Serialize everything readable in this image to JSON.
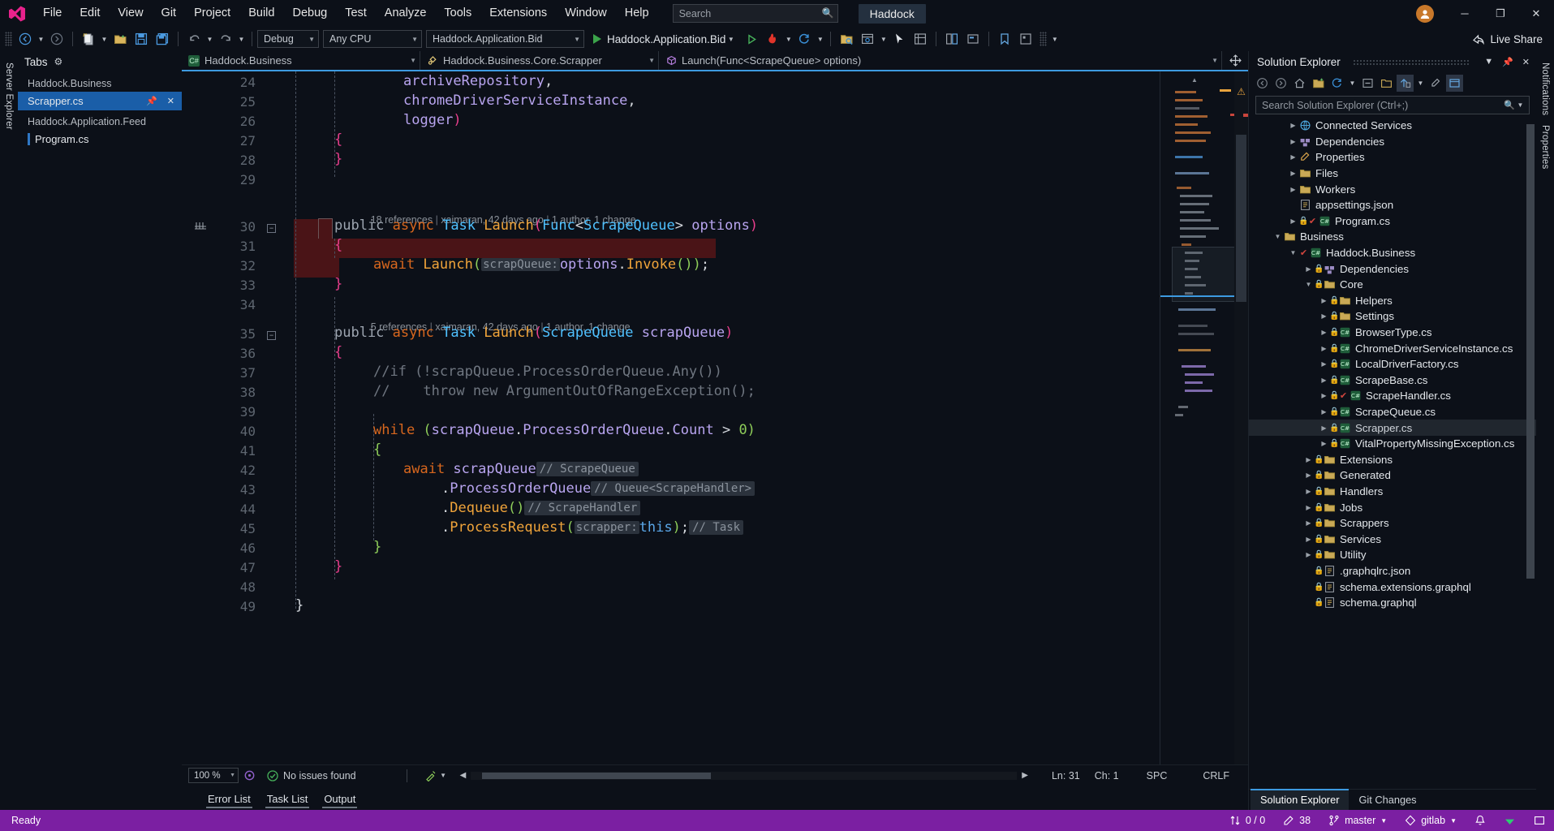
{
  "window": {
    "solution_name": "Haddock",
    "search_placeholder": "Search",
    "minimize": "─",
    "maximize": "❐",
    "close": "✕",
    "avatar_initial": ""
  },
  "menu": {
    "items": [
      {
        "label": "File"
      },
      {
        "label": "Edit"
      },
      {
        "label": "View"
      },
      {
        "label": "Git"
      },
      {
        "label": "Project"
      },
      {
        "label": "Build"
      },
      {
        "label": "Debug"
      },
      {
        "label": "Test"
      },
      {
        "label": "Analyze"
      },
      {
        "label": "Tools"
      },
      {
        "label": "Extensions"
      },
      {
        "label": "Window"
      },
      {
        "label": "Help"
      }
    ]
  },
  "toolbar": {
    "configuration": "Debug",
    "platform": "Any CPU",
    "startup_project": "Haddock.Application.Bid",
    "run_target": "Haddock.Application.Bid",
    "live_share": "Live Share"
  },
  "tool_rails": {
    "left_top": "Server Explorer",
    "right_top": "Notifications",
    "right_bottom": "Properties"
  },
  "tabs_window": {
    "title": "Tabs",
    "groups": [
      {
        "header": "Haddock.Business",
        "items": [
          {
            "label": "Scrapper.cs",
            "active": true,
            "pinned": true,
            "closable": true
          }
        ]
      },
      {
        "header": "Haddock.Application.Feed",
        "items": [
          {
            "label": "Program.cs",
            "active": false,
            "pinned": false,
            "closable": false
          }
        ]
      }
    ]
  },
  "navbar": {
    "project": "Haddock.Business",
    "type": "Haddock.Business.Core.Scrapper",
    "member": "Launch(Func<ScrapeQueue> options)"
  },
  "editor": {
    "first_line": 24,
    "lines": [
      {
        "n": 24,
        "indent": 4,
        "text": "        archiveRepository,"
      },
      {
        "n": 25,
        "indent": 4,
        "text": "        chromeDriverServiceInstance,"
      },
      {
        "n": 26,
        "indent": 4,
        "text": "        logger)"
      },
      {
        "n": 27,
        "indent": 2,
        "text": "    {"
      },
      {
        "n": 28,
        "indent": 2,
        "text": "    }"
      },
      {
        "n": 29,
        "indent": 0,
        "text": ""
      },
      {
        "n": 30,
        "indent": 2,
        "text": "    public async Task Launch(Func<ScrapeQueue> options)"
      },
      {
        "n": 31,
        "indent": 2,
        "text": "    {"
      },
      {
        "n": 32,
        "indent": 3,
        "text": "        await Launch(scrapQueue: options.Invoke());"
      },
      {
        "n": 33,
        "indent": 2,
        "text": "    }"
      },
      {
        "n": 34,
        "indent": 0,
        "text": ""
      },
      {
        "n": 35,
        "indent": 2,
        "text": "    public async Task Launch(ScrapeQueue scrapQueue)"
      },
      {
        "n": 36,
        "indent": 2,
        "text": "    {"
      },
      {
        "n": 37,
        "indent": 3,
        "text": "        //if (!scrapQueue.ProcessOrderQueue.Any())"
      },
      {
        "n": 38,
        "indent": 3,
        "text": "        //    throw new ArgumentOutOfRangeException();"
      },
      {
        "n": 39,
        "indent": 0,
        "text": ""
      },
      {
        "n": 40,
        "indent": 3,
        "text": "        while (scrapQueue.ProcessOrderQueue.Count > 0)"
      },
      {
        "n": 41,
        "indent": 3,
        "text": "        {"
      },
      {
        "n": 42,
        "indent": 4,
        "text": "            await scrapQueue"
      },
      {
        "n": 43,
        "indent": 5,
        "text": "                .ProcessOrderQueue"
      },
      {
        "n": 44,
        "indent": 5,
        "text": "                .Dequeue()"
      },
      {
        "n": 45,
        "indent": 5,
        "text": "                .ProcessRequest(scrapper: this);"
      },
      {
        "n": 46,
        "indent": 3,
        "text": "        }"
      },
      {
        "n": 47,
        "indent": 2,
        "text": "    }"
      },
      {
        "n": 48,
        "indent": 0,
        "text": ""
      },
      {
        "n": 49,
        "indent": 0,
        "text": "}"
      }
    ],
    "codelens": [
      {
        "at_line": 30,
        "references": "18 references",
        "author": "xaimaran, 42 days ago",
        "changes": "1 author, 1 change"
      },
      {
        "at_line": 35,
        "references": "5 references",
        "author": "xaimaran, 42 days ago",
        "changes": "1 author, 1 change"
      }
    ],
    "inline_hints": [
      {
        "at_line": 32,
        "text": "scrapQueue:"
      },
      {
        "at_line": 42,
        "text": "// ScrapeQueue"
      },
      {
        "at_line": 43,
        "text": "// Queue<ScrapeHandler>"
      },
      {
        "at_line": 44,
        "text": "// ScrapeHandler"
      },
      {
        "at_line": 45,
        "text": "// Task"
      },
      {
        "at_line": 45,
        "text": "scrapper:"
      }
    ],
    "highlighted_lines": [
      31,
      32,
      33
    ]
  },
  "editor_status": {
    "zoom": "100 %",
    "issues": "No issues found",
    "line": "Ln: 31",
    "col": "Ch: 1",
    "spaces": "SPC",
    "eol": "CRLF"
  },
  "solution_explorer": {
    "title": "Solution Explorer",
    "search_placeholder": "Search Solution Explorer (Ctrl+;)",
    "tabs": [
      {
        "label": "Solution Explorer",
        "active": true
      },
      {
        "label": "Git Changes",
        "active": false
      }
    ],
    "tree": [
      {
        "label": "Connected Services",
        "depth": 2,
        "icon": "services",
        "arrow": true
      },
      {
        "label": "Dependencies",
        "depth": 2,
        "icon": "deps",
        "arrow": true
      },
      {
        "label": "Properties",
        "depth": 2,
        "icon": "props",
        "arrow": true
      },
      {
        "label": "Files",
        "depth": 2,
        "icon": "folder",
        "arrow": true
      },
      {
        "label": "Workers",
        "depth": 2,
        "icon": "folder",
        "arrow": true
      },
      {
        "label": "appsettings.json",
        "depth": 2,
        "icon": "json",
        "arrow": false
      },
      {
        "label": "Program.cs",
        "depth": 2,
        "icon": "cs-check",
        "arrow": true
      },
      {
        "label": "Business",
        "depth": 1,
        "icon": "folder",
        "arrow": true,
        "expanded": true
      },
      {
        "label": "Haddock.Business",
        "depth": 2,
        "icon": "proj-check",
        "arrow": true,
        "expanded": true
      },
      {
        "label": "Dependencies",
        "depth": 3,
        "icon": "deps",
        "arrow": true
      },
      {
        "label": "Core",
        "depth": 3,
        "icon": "folder",
        "arrow": true,
        "expanded": true
      },
      {
        "label": "Helpers",
        "depth": 4,
        "icon": "folder",
        "arrow": true
      },
      {
        "label": "Settings",
        "depth": 4,
        "icon": "folder",
        "arrow": true
      },
      {
        "label": "BrowserType.cs",
        "depth": 4,
        "icon": "cs",
        "arrow": true
      },
      {
        "label": "ChromeDriverServiceInstance.cs",
        "depth": 4,
        "icon": "cs",
        "arrow": true
      },
      {
        "label": "LocalDriverFactory.cs",
        "depth": 4,
        "icon": "cs",
        "arrow": true
      },
      {
        "label": "ScrapeBase.cs",
        "depth": 4,
        "icon": "cs",
        "arrow": true
      },
      {
        "label": "ScrapeHandler.cs",
        "depth": 4,
        "icon": "cs-check",
        "arrow": true
      },
      {
        "label": "ScrapeQueue.cs",
        "depth": 4,
        "icon": "cs",
        "arrow": true
      },
      {
        "label": "Scrapper.cs",
        "depth": 4,
        "icon": "cs",
        "arrow": true,
        "selected": true
      },
      {
        "label": "VitalPropertyMissingException.cs",
        "depth": 4,
        "icon": "cs",
        "arrow": true
      },
      {
        "label": "Extensions",
        "depth": 3,
        "icon": "folder",
        "arrow": true
      },
      {
        "label": "Generated",
        "depth": 3,
        "icon": "folder",
        "arrow": true
      },
      {
        "label": "Handlers",
        "depth": 3,
        "icon": "folder",
        "arrow": true
      },
      {
        "label": "Jobs",
        "depth": 3,
        "icon": "folder",
        "arrow": true
      },
      {
        "label": "Scrappers",
        "depth": 3,
        "icon": "folder",
        "arrow": true
      },
      {
        "label": "Services",
        "depth": 3,
        "icon": "folder",
        "arrow": true
      },
      {
        "label": "Utility",
        "depth": 3,
        "icon": "folder",
        "arrow": true
      },
      {
        "label": ".graphqlrc.json",
        "depth": 3,
        "icon": "json",
        "arrow": false
      },
      {
        "label": "schema.extensions.graphql",
        "depth": 3,
        "icon": "json",
        "arrow": false
      },
      {
        "label": "schema.graphql",
        "depth": 3,
        "icon": "json",
        "arrow": false
      }
    ]
  },
  "bottom_tabs": [
    {
      "label": "Error List"
    },
    {
      "label": "Task List"
    },
    {
      "label": "Output"
    }
  ],
  "statusbar": {
    "state": "Ready",
    "sync": "0 / 0",
    "changes": "38",
    "branch": "master",
    "remote": "gitlab",
    "bell": "🔔"
  },
  "colors": {
    "accent_purple": "#7b1fa2",
    "accent_blue": "#3d9ae0",
    "selection_blue": "#1a5ea8",
    "highlight_red": "#4a1417",
    "vs_pink": "#e83e8c"
  }
}
